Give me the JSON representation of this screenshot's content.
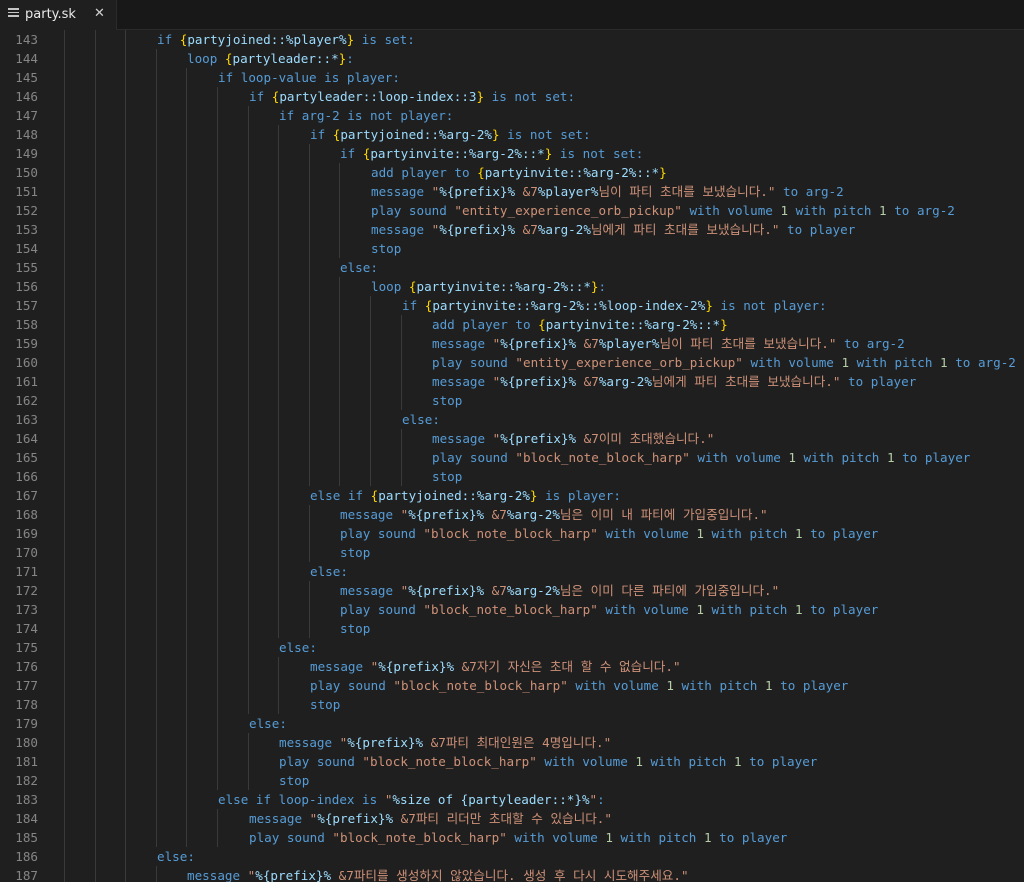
{
  "tab": {
    "file_name": "party.sk",
    "file_icon": "lines-icon",
    "close_glyph": "✕"
  },
  "colors": {
    "background": "#1f1f1f",
    "keyword": "#569cd6",
    "brace": "#ffd700",
    "variable": "#9cdcfe",
    "string": "#ce9178",
    "number": "#b5cea8",
    "line_number": "#858585"
  },
  "lines": [
    {
      "n": "143",
      "indent": 3,
      "tokens": [
        [
          "kw",
          "if "
        ],
        [
          "brace",
          "{"
        ],
        [
          "var",
          "partyjoined::%player%"
        ],
        [
          "brace",
          "}"
        ],
        [
          "kw",
          " is set:"
        ]
      ]
    },
    {
      "n": "144",
      "indent": 4,
      "tokens": [
        [
          "kw",
          "loop "
        ],
        [
          "brace",
          "{"
        ],
        [
          "var",
          "partyleader::*"
        ],
        [
          "brace",
          "}"
        ],
        [
          "kw",
          ":"
        ]
      ]
    },
    {
      "n": "145",
      "indent": 5,
      "tokens": [
        [
          "kw",
          "if loop-value is player:"
        ]
      ]
    },
    {
      "n": "146",
      "indent": 6,
      "tokens": [
        [
          "kw",
          "if "
        ],
        [
          "brace",
          "{"
        ],
        [
          "var",
          "partyleader::loop-index::3"
        ],
        [
          "brace",
          "}"
        ],
        [
          "kw",
          " is not set:"
        ]
      ]
    },
    {
      "n": "147",
      "indent": 7,
      "tokens": [
        [
          "kw",
          "if arg-2 is not player:"
        ]
      ]
    },
    {
      "n": "148",
      "indent": 8,
      "tokens": [
        [
          "kw",
          "if "
        ],
        [
          "brace",
          "{"
        ],
        [
          "var",
          "partyjoined::%arg-2%"
        ],
        [
          "brace",
          "}"
        ],
        [
          "kw",
          " is not set:"
        ]
      ]
    },
    {
      "n": "149",
      "indent": 9,
      "tokens": [
        [
          "kw",
          "if "
        ],
        [
          "brace",
          "{"
        ],
        [
          "var",
          "partyinvite::%arg-2%::*"
        ],
        [
          "brace",
          "}"
        ],
        [
          "kw",
          " is not set:"
        ]
      ]
    },
    {
      "n": "150",
      "indent": 10,
      "tokens": [
        [
          "kw",
          "add player to "
        ],
        [
          "brace",
          "{"
        ],
        [
          "var",
          "partyinvite::%arg-2%::*"
        ],
        [
          "brace",
          "}"
        ]
      ]
    },
    {
      "n": "151",
      "indent": 10,
      "tokens": [
        [
          "kw",
          "message "
        ],
        [
          "str",
          "\""
        ],
        [
          "var",
          "%{prefix}%"
        ],
        [
          "str",
          " &7"
        ],
        [
          "var",
          "%player%"
        ],
        [
          "str",
          "님이 파티 초대를 보냈습니다.\""
        ],
        [
          "kw",
          " to arg-2"
        ]
      ]
    },
    {
      "n": "152",
      "indent": 10,
      "tokens": [
        [
          "kw",
          "play sound "
        ],
        [
          "str",
          "\"entity_experience_orb_pickup\""
        ],
        [
          "kw",
          " with volume "
        ],
        [
          "num",
          "1"
        ],
        [
          "kw",
          " with pitch "
        ],
        [
          "num",
          "1"
        ],
        [
          "kw",
          " to arg-2"
        ]
      ]
    },
    {
      "n": "153",
      "indent": 10,
      "tokens": [
        [
          "kw",
          "message "
        ],
        [
          "str",
          "\""
        ],
        [
          "var",
          "%{prefix}%"
        ],
        [
          "str",
          " &7"
        ],
        [
          "var",
          "%arg-2%"
        ],
        [
          "str",
          "님에게 파티 초대를 보냈습니다.\""
        ],
        [
          "kw",
          " to player"
        ]
      ]
    },
    {
      "n": "154",
      "indent": 10,
      "tokens": [
        [
          "kw",
          "stop"
        ]
      ]
    },
    {
      "n": "155",
      "indent": 9,
      "tokens": [
        [
          "kw",
          "else:"
        ]
      ]
    },
    {
      "n": "156",
      "indent": 10,
      "tokens": [
        [
          "kw",
          "loop "
        ],
        [
          "brace",
          "{"
        ],
        [
          "var",
          "partyinvite::%arg-2%::*"
        ],
        [
          "brace",
          "}"
        ],
        [
          "kw",
          ":"
        ]
      ]
    },
    {
      "n": "157",
      "indent": 11,
      "tokens": [
        [
          "kw",
          "if "
        ],
        [
          "brace",
          "{"
        ],
        [
          "var",
          "partyinvite::%arg-2%::%loop-index-2%"
        ],
        [
          "brace",
          "}"
        ],
        [
          "kw",
          " is not player:"
        ]
      ]
    },
    {
      "n": "158",
      "indent": 12,
      "tokens": [
        [
          "kw",
          "add player to "
        ],
        [
          "brace",
          "{"
        ],
        [
          "var",
          "partyinvite::%arg-2%::*"
        ],
        [
          "brace",
          "}"
        ]
      ]
    },
    {
      "n": "159",
      "indent": 12,
      "tokens": [
        [
          "kw",
          "message "
        ],
        [
          "str",
          "\""
        ],
        [
          "var",
          "%{prefix}%"
        ],
        [
          "str",
          " &7"
        ],
        [
          "var",
          "%player%"
        ],
        [
          "str",
          "님이 파티 초대를 보냈습니다.\""
        ],
        [
          "kw",
          " to arg-2"
        ]
      ]
    },
    {
      "n": "160",
      "indent": 12,
      "tokens": [
        [
          "kw",
          "play sound "
        ],
        [
          "str",
          "\"entity_experience_orb_pickup\""
        ],
        [
          "kw",
          " with volume "
        ],
        [
          "num",
          "1"
        ],
        [
          "kw",
          " with pitch "
        ],
        [
          "num",
          "1"
        ],
        [
          "kw",
          " to arg-2"
        ]
      ]
    },
    {
      "n": "161",
      "indent": 12,
      "tokens": [
        [
          "kw",
          "message "
        ],
        [
          "str",
          "\""
        ],
        [
          "var",
          "%{prefix}%"
        ],
        [
          "str",
          " &7"
        ],
        [
          "var",
          "%arg-2%"
        ],
        [
          "str",
          "님에게 파티 초대를 보냈습니다.\""
        ],
        [
          "kw",
          " to player"
        ]
      ]
    },
    {
      "n": "162",
      "indent": 12,
      "tokens": [
        [
          "kw",
          "stop"
        ]
      ]
    },
    {
      "n": "163",
      "indent": 11,
      "tokens": [
        [
          "kw",
          "else:"
        ]
      ]
    },
    {
      "n": "164",
      "indent": 12,
      "tokens": [
        [
          "kw",
          "message "
        ],
        [
          "str",
          "\""
        ],
        [
          "var",
          "%{prefix}%"
        ],
        [
          "str",
          " &7이미 초대했습니다.\""
        ]
      ]
    },
    {
      "n": "165",
      "indent": 12,
      "tokens": [
        [
          "kw",
          "play sound "
        ],
        [
          "str",
          "\"block_note_block_harp\""
        ],
        [
          "kw",
          " with volume "
        ],
        [
          "num",
          "1"
        ],
        [
          "kw",
          " with pitch "
        ],
        [
          "num",
          "1"
        ],
        [
          "kw",
          " to player"
        ]
      ]
    },
    {
      "n": "166",
      "indent": 12,
      "tokens": [
        [
          "kw",
          "stop"
        ]
      ]
    },
    {
      "n": "167",
      "indent": 8,
      "tokens": [
        [
          "kw",
          "else if "
        ],
        [
          "brace",
          "{"
        ],
        [
          "var",
          "partyjoined::%arg-2%"
        ],
        [
          "brace",
          "}"
        ],
        [
          "kw",
          " is player:"
        ]
      ]
    },
    {
      "n": "168",
      "indent": 9,
      "tokens": [
        [
          "kw",
          "message "
        ],
        [
          "str",
          "\""
        ],
        [
          "var",
          "%{prefix}%"
        ],
        [
          "str",
          " &7"
        ],
        [
          "var",
          "%arg-2%"
        ],
        [
          "str",
          "님은 이미 내 파티에 가입중입니다.\""
        ]
      ]
    },
    {
      "n": "169",
      "indent": 9,
      "tokens": [
        [
          "kw",
          "play sound "
        ],
        [
          "str",
          "\"block_note_block_harp\""
        ],
        [
          "kw",
          " with volume "
        ],
        [
          "num",
          "1"
        ],
        [
          "kw",
          " with pitch "
        ],
        [
          "num",
          "1"
        ],
        [
          "kw",
          " to player"
        ]
      ]
    },
    {
      "n": "170",
      "indent": 9,
      "tokens": [
        [
          "kw",
          "stop"
        ]
      ]
    },
    {
      "n": "171",
      "indent": 8,
      "tokens": [
        [
          "kw",
          "else:"
        ]
      ]
    },
    {
      "n": "172",
      "indent": 9,
      "tokens": [
        [
          "kw",
          "message "
        ],
        [
          "str",
          "\""
        ],
        [
          "var",
          "%{prefix}%"
        ],
        [
          "str",
          " &7"
        ],
        [
          "var",
          "%arg-2%"
        ],
        [
          "str",
          "님은 이미 다른 파티에 가입중입니다.\""
        ]
      ]
    },
    {
      "n": "173",
      "indent": 9,
      "tokens": [
        [
          "kw",
          "play sound "
        ],
        [
          "str",
          "\"block_note_block_harp\""
        ],
        [
          "kw",
          " with volume "
        ],
        [
          "num",
          "1"
        ],
        [
          "kw",
          " with pitch "
        ],
        [
          "num",
          "1"
        ],
        [
          "kw",
          " to player"
        ]
      ]
    },
    {
      "n": "174",
      "indent": 9,
      "tokens": [
        [
          "kw",
          "stop"
        ]
      ]
    },
    {
      "n": "175",
      "indent": 7,
      "tokens": [
        [
          "kw",
          "else:"
        ]
      ]
    },
    {
      "n": "176",
      "indent": 8,
      "tokens": [
        [
          "kw",
          "message "
        ],
        [
          "str",
          "\""
        ],
        [
          "var",
          "%{prefix}%"
        ],
        [
          "str",
          " &7자기 자신은 초대 할 수 없습니다.\""
        ]
      ]
    },
    {
      "n": "177",
      "indent": 8,
      "tokens": [
        [
          "kw",
          "play sound "
        ],
        [
          "str",
          "\"block_note_block_harp\""
        ],
        [
          "kw",
          " with volume "
        ],
        [
          "num",
          "1"
        ],
        [
          "kw",
          " with pitch "
        ],
        [
          "num",
          "1"
        ],
        [
          "kw",
          " to player"
        ]
      ]
    },
    {
      "n": "178",
      "indent": 8,
      "tokens": [
        [
          "kw",
          "stop"
        ]
      ]
    },
    {
      "n": "179",
      "indent": 6,
      "tokens": [
        [
          "kw",
          "else:"
        ]
      ]
    },
    {
      "n": "180",
      "indent": 7,
      "tokens": [
        [
          "kw",
          "message "
        ],
        [
          "str",
          "\""
        ],
        [
          "var",
          "%{prefix}%"
        ],
        [
          "str",
          " &7파티 최대인원은 4명입니다.\""
        ]
      ]
    },
    {
      "n": "181",
      "indent": 7,
      "tokens": [
        [
          "kw",
          "play sound "
        ],
        [
          "str",
          "\"block_note_block_harp\""
        ],
        [
          "kw",
          " with volume "
        ],
        [
          "num",
          "1"
        ],
        [
          "kw",
          " with pitch "
        ],
        [
          "num",
          "1"
        ],
        [
          "kw",
          " to player"
        ]
      ]
    },
    {
      "n": "182",
      "indent": 7,
      "tokens": [
        [
          "kw",
          "stop"
        ]
      ]
    },
    {
      "n": "183",
      "indent": 5,
      "tokens": [
        [
          "kw",
          "else if loop-index is "
        ],
        [
          "str",
          "\""
        ],
        [
          "var",
          "%size of {partyleader::*}%"
        ],
        [
          "str",
          "\""
        ],
        [
          "kw",
          ":"
        ]
      ]
    },
    {
      "n": "184",
      "indent": 6,
      "tokens": [
        [
          "kw",
          "message "
        ],
        [
          "str",
          "\""
        ],
        [
          "var",
          "%{prefix}%"
        ],
        [
          "str",
          " &7파티 리더만 초대할 수 있습니다.\""
        ]
      ]
    },
    {
      "n": "185",
      "indent": 6,
      "tokens": [
        [
          "kw",
          "play sound "
        ],
        [
          "str",
          "\"block_note_block_harp\""
        ],
        [
          "kw",
          " with volume "
        ],
        [
          "num",
          "1"
        ],
        [
          "kw",
          " with pitch "
        ],
        [
          "num",
          "1"
        ],
        [
          "kw",
          " to player"
        ]
      ]
    },
    {
      "n": "186",
      "indent": 3,
      "tokens": [
        [
          "kw",
          "else:"
        ]
      ]
    },
    {
      "n": "187",
      "indent": 4,
      "tokens": [
        [
          "kw",
          "message "
        ],
        [
          "str",
          "\""
        ],
        [
          "var",
          "%{prefix}%"
        ],
        [
          "str",
          " &7파티를 생성하지 않았습니다. 생성 후 다시 시도해주세요.\""
        ]
      ]
    }
  ]
}
